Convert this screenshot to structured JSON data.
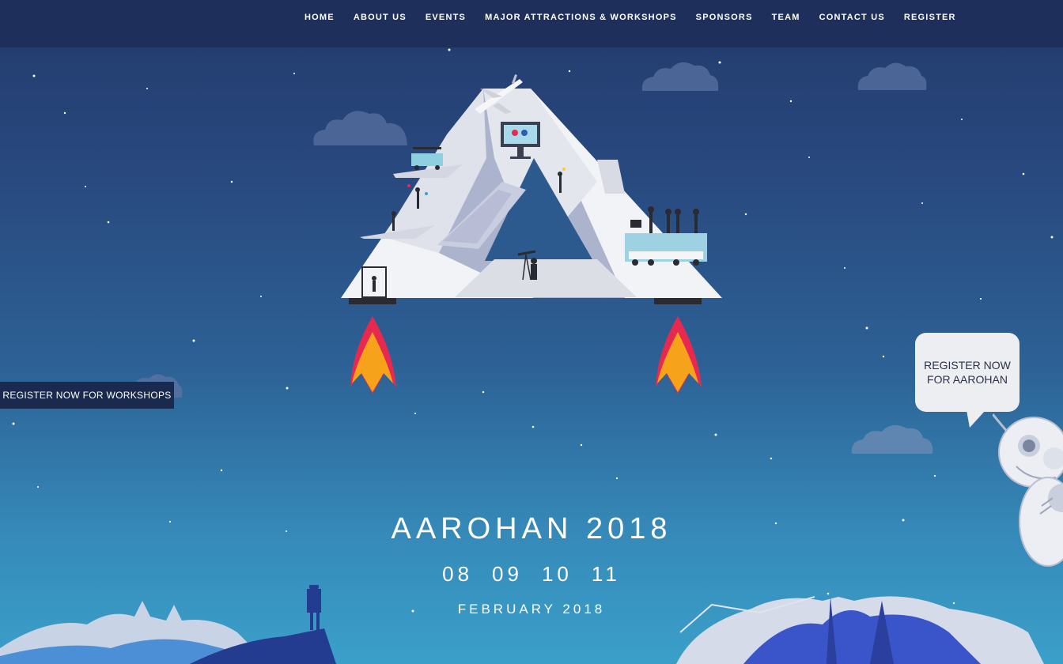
{
  "nav": {
    "items": [
      {
        "label": "HOME"
      },
      {
        "label": "ABOUT US"
      },
      {
        "label": "EVENTS"
      },
      {
        "label": "MAJOR ATTRACTIONS & WORKSHOPS"
      },
      {
        "label": "SPONSORS"
      },
      {
        "label": "TEAM"
      },
      {
        "label": "CONTACT US"
      },
      {
        "label": "REGISTER"
      }
    ]
  },
  "side_button": {
    "label": "REGISTER NOW FOR WORKSHOPS"
  },
  "bubble": {
    "label": "REGISTER NOW FOR AAROHAN"
  },
  "hero": {
    "title": "AAROHAN 2018",
    "dates": [
      "08",
      "09",
      "10",
      "11"
    ],
    "month": "FEBRUARY 2018"
  },
  "illustration": {
    "name": "pyramid-rocket-illustration",
    "icons": [
      "airplane-icon",
      "monitor-icon",
      "golf-cart-icon",
      "telescope-icon",
      "film-crew-icon",
      "flame-icon"
    ]
  },
  "colors": {
    "nav_bg": "#1f2f5c",
    "sky_top": "#233a6b",
    "sky_bottom": "#3ba0c9",
    "flame_red": "#e8294f",
    "flame_orange": "#f7a21b",
    "button_bg": "#1a2a4f"
  }
}
